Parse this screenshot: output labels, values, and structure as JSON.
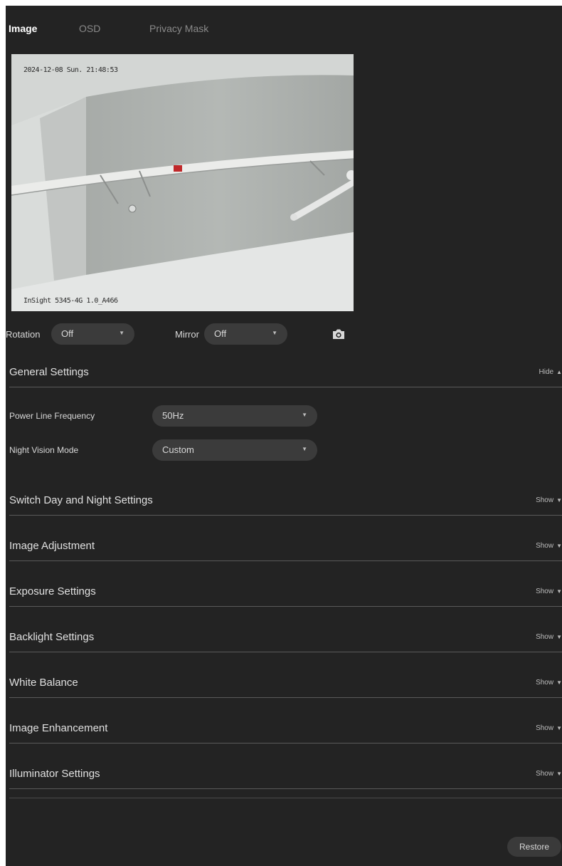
{
  "tabs": [
    {
      "label": "Image",
      "active": true
    },
    {
      "label": "OSD",
      "active": false
    },
    {
      "label": "Privacy Mask",
      "active": false
    }
  ],
  "preview": {
    "timestamp": "2024-12-08 Sun. 21:48:53",
    "camera_label": "InSight 5345-4G 1.0_A466"
  },
  "controls": {
    "rotation_label": "Rotation",
    "rotation_value": "Off",
    "mirror_label": "Mirror",
    "mirror_value": "Off",
    "snapshot_icon": "camera-icon"
  },
  "general": {
    "title": "General Settings",
    "toggle": "Hide",
    "power_line_label": "Power Line Frequency",
    "power_line_value": "50Hz",
    "night_vision_label": "Night Vision Mode",
    "night_vision_value": "Custom"
  },
  "sections": [
    {
      "title": "Switch Day and Night Settings",
      "toggle": "Show"
    },
    {
      "title": "Image Adjustment",
      "toggle": "Show"
    },
    {
      "title": "Exposure Settings",
      "toggle": "Show"
    },
    {
      "title": "Backlight Settings",
      "toggle": "Show"
    },
    {
      "title": "White Balance",
      "toggle": "Show"
    },
    {
      "title": "Image Enhancement",
      "toggle": "Show"
    },
    {
      "title": "Illuminator Settings",
      "toggle": "Show"
    }
  ],
  "restore_label": "Restore",
  "colors": {
    "panel_bg": "#232323",
    "pill_bg": "#3b3b3b",
    "divider": "#5a5a5a"
  }
}
